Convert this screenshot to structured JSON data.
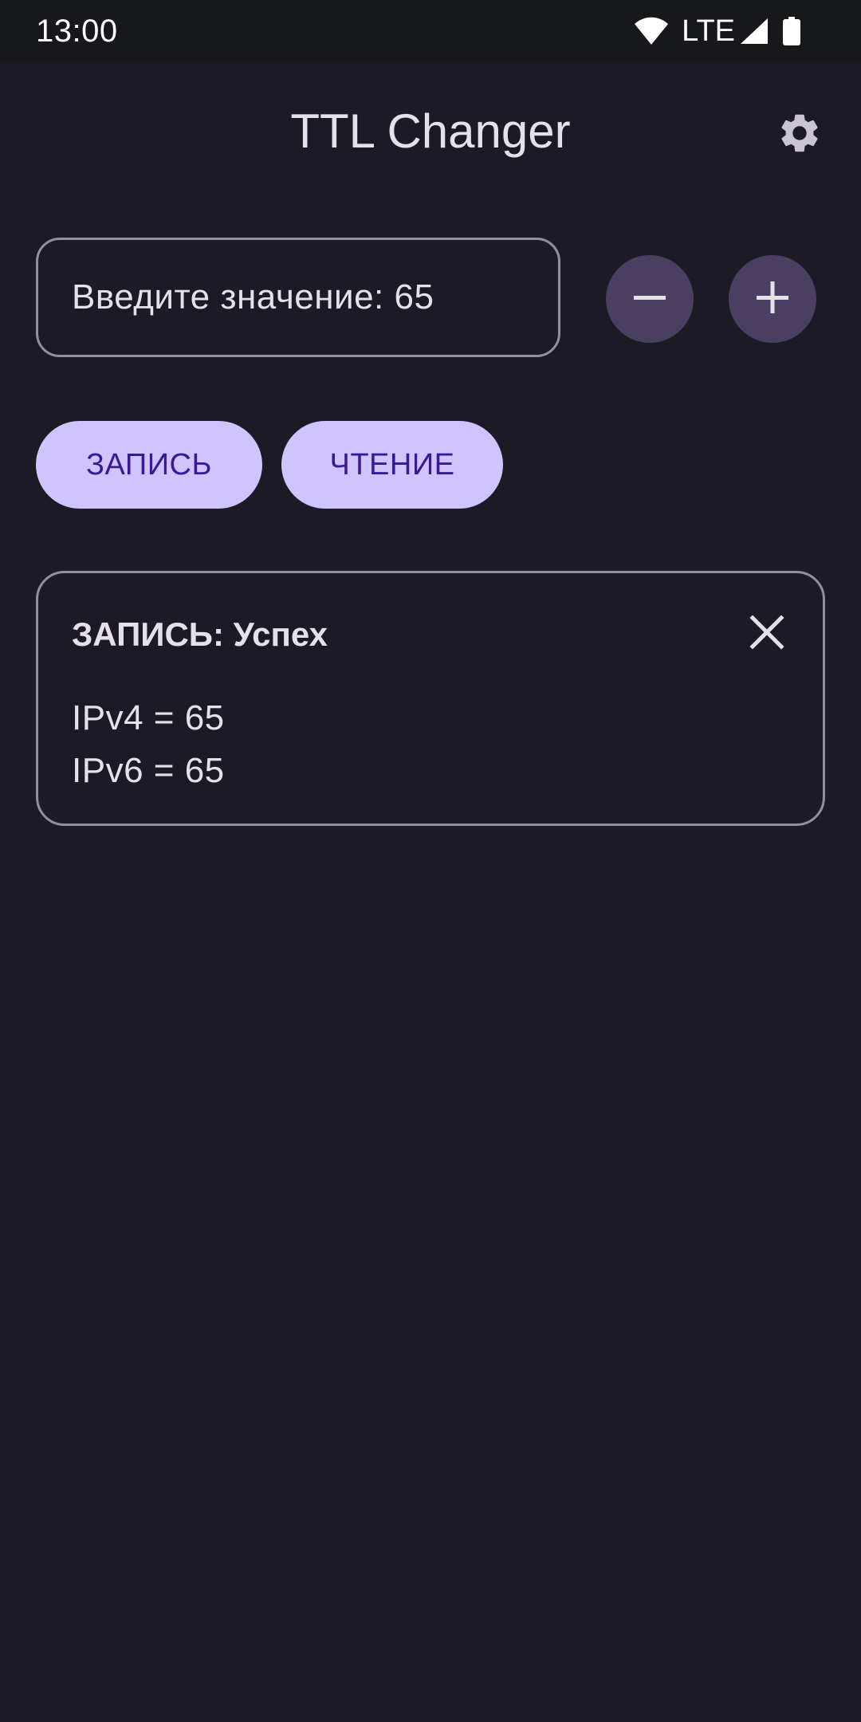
{
  "status_bar": {
    "time": "13:00",
    "network": "LTE",
    "icons": [
      "wifi-icon",
      "signal-icon",
      "battery-icon"
    ]
  },
  "app": {
    "title": "TTL Changer",
    "settings_icon": "gear-icon"
  },
  "ttl_input": {
    "value": "Введите значение: 65"
  },
  "stepper": {
    "decrement_icon": "minus-icon",
    "increment_icon": "plus-icon"
  },
  "actions": {
    "write_label": "ЗАПИСЬ",
    "read_label": "ЧТЕНИЕ"
  },
  "result": {
    "title": "ЗАПИСЬ: Успех",
    "lines": [
      "IPv4 = 65",
      "IPv6 = 65"
    ],
    "close_icon": "close-icon"
  },
  "colors": {
    "background": "#1c1b25",
    "status_bar": "#17181c",
    "on_surface": "#e6e1e9",
    "outline": "#938f9a",
    "tonal_button": "#4b3f61",
    "primary_container": "#cfc4ff",
    "on_primary_container": "#3a1a93"
  }
}
